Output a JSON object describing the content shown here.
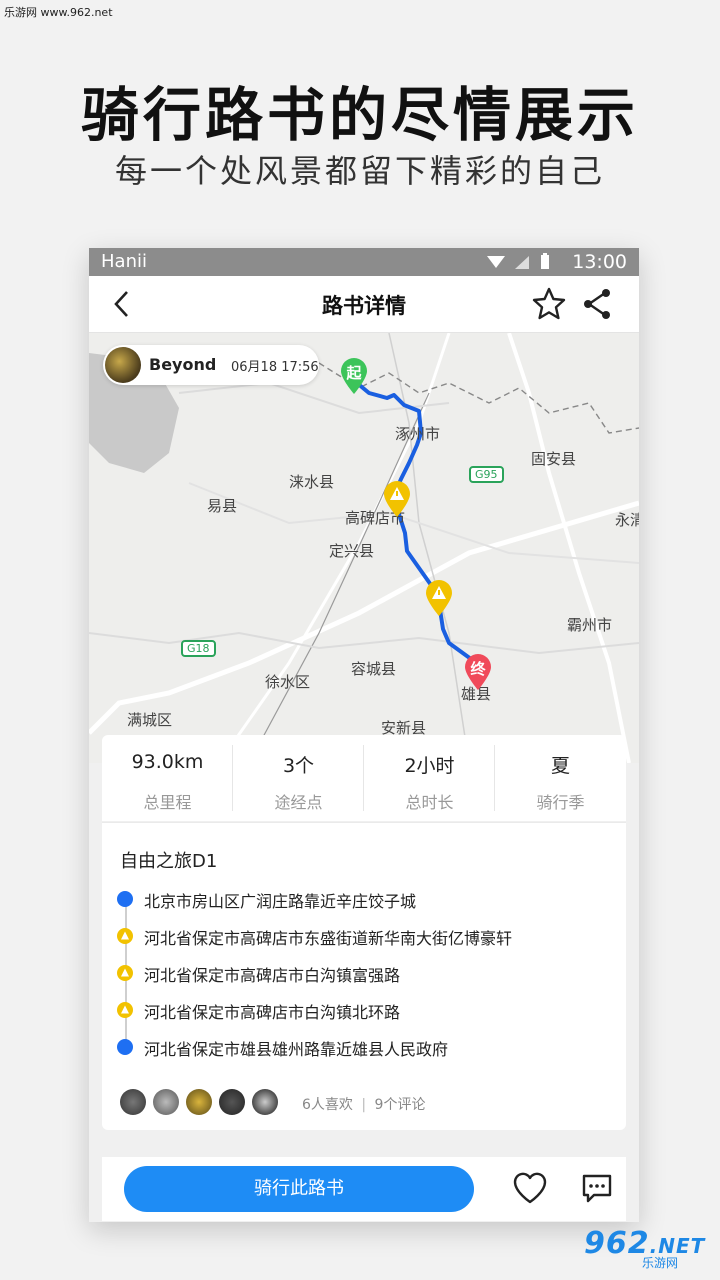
{
  "watermark": {
    "top_left": "乐游网 www.962.net",
    "brand_number": "962",
    "brand_suffix": ".NET",
    "brand_name": "乐游网"
  },
  "hero": {
    "title": "骑行路书的尽情展示",
    "subtitle": "每一个处风景都留下精彩的自己"
  },
  "status_bar": {
    "carrier": "Hanii",
    "time": "13:00"
  },
  "nav": {
    "title": "路书详情",
    "back_icon": "chevron-left-icon",
    "star_icon": "star-icon",
    "share_icon": "share-icon"
  },
  "map": {
    "user": {
      "name": "Beyond",
      "date": "06月18 17:56"
    },
    "start_label": "起",
    "end_label": "终",
    "places": {
      "zhuozhou": "涿州市",
      "guan": "固安县",
      "laishui": "涞水县",
      "g95": "G95",
      "yixian": "易县",
      "gaobeidian": "高碑店市",
      "yong": "永清",
      "dingxing": "定兴县",
      "bazhou": "霸州市",
      "g18": "G18",
      "rongcheng": "容城县",
      "xushui": "徐水区",
      "xiongxian": "雄县",
      "mancheng": "满城区",
      "anxin": "安新县"
    }
  },
  "stats": [
    {
      "value": "93.0km",
      "label": "总里程"
    },
    {
      "value": "3个",
      "label": "途经点"
    },
    {
      "value": "2小时",
      "label": "总时长"
    },
    {
      "value": "夏",
      "label": "骑行季"
    }
  ],
  "route": {
    "title": "自由之旅D1",
    "waypoints": [
      {
        "text": "北京市房山区广润庄路靠近辛庄饺子城",
        "type": "endpoint"
      },
      {
        "text": "河北省保定市高碑店市东盛街道新华南大街亿博豪轩",
        "type": "waypoint"
      },
      {
        "text": "河北省保定市高碑店市白沟镇富强路",
        "type": "waypoint"
      },
      {
        "text": "河北省保定市高碑店市白沟镇北环路",
        "type": "waypoint"
      },
      {
        "text": "河北省保定市雄县雄州路靠近雄县人民政府",
        "type": "endpoint"
      }
    ],
    "likes_text": "6人喜欢",
    "separator": "|",
    "comments_text": "9个评论"
  },
  "actions": {
    "ride_button": "骑行此路书",
    "like_icon": "heart-icon",
    "comment_icon": "comment-icon"
  },
  "colors": {
    "primary": "#1e8cf5",
    "route_line": "#1a5fe0",
    "start_pin": "#3cc45a",
    "end_pin": "#f04a5a",
    "waypoint_pin": "#f2c200"
  }
}
